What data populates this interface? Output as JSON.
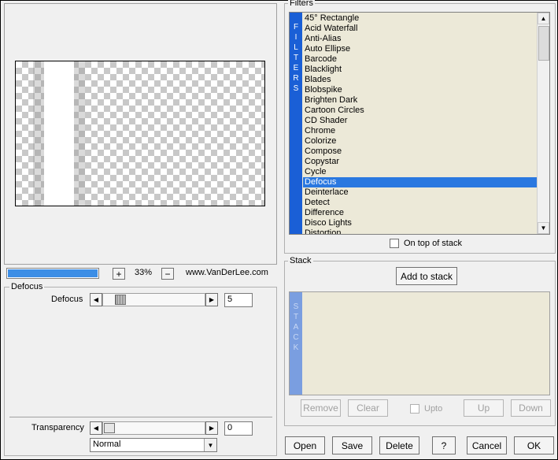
{
  "zoom": {
    "progress_percent": 100,
    "minus_label": "−",
    "plus_label": "+",
    "level": "33%",
    "website": "www.VanDerLee.com"
  },
  "filter_group": {
    "title": "Defocus",
    "param_label": "Defocus",
    "param_value": "5",
    "slider_fraction": 0.03
  },
  "transparency": {
    "label": "Transparency",
    "value": "0",
    "slider_fraction": 0.0,
    "blend_mode": "Normal"
  },
  "filters": {
    "title": "Filters",
    "strip_letters": [
      "F",
      "I",
      "L",
      "T",
      "E",
      "R",
      "S"
    ],
    "items": [
      "45° Rectangle",
      "Acid Waterfall",
      "Anti-Alias",
      "Auto Ellipse",
      "Barcode",
      "Blacklight",
      "Blades",
      "Blobspike",
      "Brighten Dark",
      "Cartoon Circles",
      "CD Shader",
      "Chrome",
      "Colorize",
      "Compose",
      "Copystar",
      "Cycle",
      "Defocus",
      "Deinterlace",
      "Detect",
      "Difference",
      "Disco Lights",
      "Distortion"
    ],
    "selected": "Defocus",
    "on_top_label": "On top of stack"
  },
  "stack": {
    "title": "Stack",
    "add_label": "Add to stack",
    "strip_letters": [
      "S",
      "T",
      "A",
      "C",
      "K"
    ],
    "remove_label": "Remove",
    "clear_label": "Clear",
    "upto_label": "Upto",
    "up_label": "Up",
    "down_label": "Down"
  },
  "buttons": {
    "open": "Open",
    "save": "Save",
    "delete": "Delete",
    "help": "?",
    "cancel": "Cancel",
    "ok": "OK"
  },
  "colors": {
    "accent": "#2a78e0",
    "strip": "#1a5fd6",
    "list_bg": "#ece9d8"
  }
}
